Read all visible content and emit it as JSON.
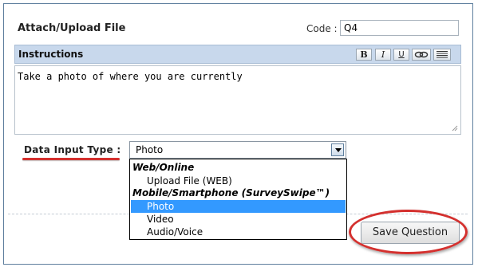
{
  "form": {
    "title": "Attach/Upload File",
    "code_label": "Code :",
    "code_value": "Q4"
  },
  "instructions": {
    "title": "Instructions",
    "toolbar": {
      "bold_label": "B",
      "italic_label": "I",
      "underline_label": "U",
      "link_icon": "link-icon",
      "list_icon": "list-icon"
    },
    "text": "Take a photo of where you are currently"
  },
  "data_input": {
    "label": "Data Input Type :",
    "selected": "Photo",
    "groups": [
      {
        "label": "Web/Online",
        "options": [
          "Upload File (WEB)"
        ]
      },
      {
        "label": "Mobile/Smartphone (SurveySwipe™)",
        "options": [
          "Photo",
          "Video",
          "Audio/Voice"
        ]
      }
    ],
    "highlighted_option": "Photo"
  },
  "actions": {
    "save_label": "Save Question"
  },
  "colors": {
    "frame_border": "#5f7f9e",
    "header_bar": "#c8d8ec",
    "highlight": "#3399ff",
    "annotation_red": "#d4302e"
  }
}
